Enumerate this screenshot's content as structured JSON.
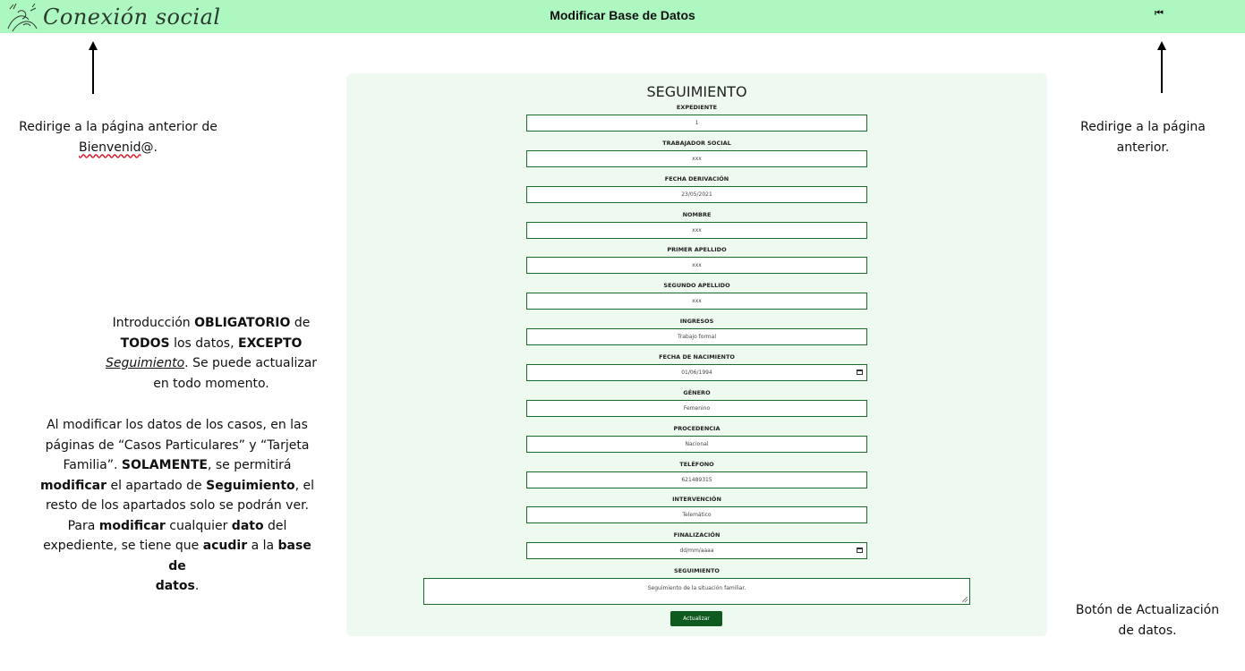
{
  "header": {
    "brand": "Conexión social",
    "title": "Modificar Base de Datos",
    "back_icon": "⏮"
  },
  "annotations": {
    "logo_note": [
      "Redirige a la página anterior de",
      "Bienvenid",
      "@."
    ],
    "back_note": [
      "Redirige a la página",
      "anterior."
    ],
    "mandatory_note": {
      "p1": "Introducción ",
      "b1": "OBLIGATORIO",
      "p2": " de",
      "b2": "TODOS",
      "p3": " los datos, ",
      "b3": "EXCEPTO",
      "u1": "Seguimiento",
      "p4": ". Se puede actualizar",
      "p5": "en todo momento."
    },
    "modify_note": {
      "l1": "Al modificar los datos de los casos, en las",
      "l2": "páginas de “Casos Particulares” y “Tarjeta",
      "l3a": "Familia”. ",
      "l3b": "SOLAMENTE",
      "l3c": ", se permitirá",
      "l4a": "modificar",
      "l4b": " el apartado de ",
      "l4c": "Seguimiento",
      "l4d": ", el",
      "l5": "resto de los apartados solo se podrán ver.",
      "l6a": "Para ",
      "l6b": "modificar",
      "l6c": " cualquier ",
      "l6d": "dato",
      "l6e": " del",
      "l7a": "expediente, se tiene que ",
      "l7b": "acudir",
      "l7c": " a la ",
      "l7d": "base de",
      "l8a": "datos",
      "l8b": "."
    },
    "button_note": [
      "Botón de Actualización",
      "de datos."
    ]
  },
  "form": {
    "title": "SEGUIMIENTO",
    "fields": [
      {
        "label": "EXPEDIENTE",
        "value": "1",
        "type": "text"
      },
      {
        "label": "TRABAJADOR SOCIAL",
        "value": "xxx",
        "type": "text"
      },
      {
        "label": "FECHA DERIVACIÓN",
        "value": "23/05/2021",
        "type": "text"
      },
      {
        "label": "NOMBRE",
        "value": "xxx",
        "type": "text"
      },
      {
        "label": "PRIMER APELLIDO",
        "value": "xxx",
        "type": "text"
      },
      {
        "label": "SEGUNDO APELLIDO",
        "value": "xxx",
        "type": "text"
      },
      {
        "label": "INGRESOS",
        "value": "Trabajo formal",
        "type": "text"
      },
      {
        "label": "FECHA DE NACIMIENTO",
        "value": "01/06/1994",
        "type": "date"
      },
      {
        "label": "GÉNERO",
        "value": "Femenino",
        "type": "text"
      },
      {
        "label": "PROCEDENCIA",
        "value": "Nacional",
        "type": "text"
      },
      {
        "label": "TELÉFONO",
        "value": "621489315",
        "type": "text"
      },
      {
        "label": "INTERVENCIÓN",
        "value": "Telemático",
        "type": "text"
      },
      {
        "label": "FINALIZACIÓN",
        "value": "dd/mm/aaaa",
        "type": "date"
      }
    ],
    "followup": {
      "label": "SEGUIMIENTO",
      "value": "Seguimiento de la situación familiar."
    },
    "submit_label": "Actualizar"
  }
}
